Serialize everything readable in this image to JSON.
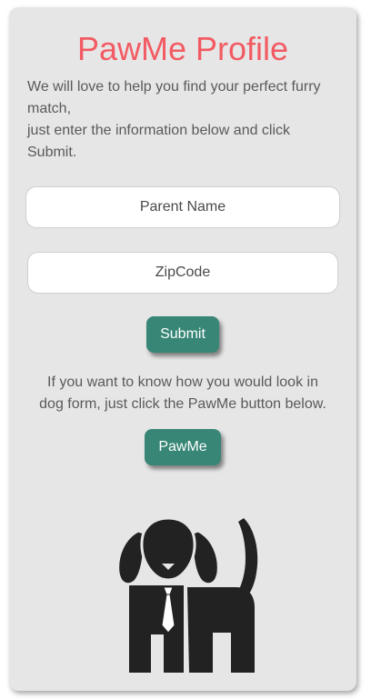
{
  "profile": {
    "title": "PawMe Profile",
    "intro_lines": [
      "We will love to help you find your perfect furry match,",
      "just enter the information below and click Submit."
    ]
  },
  "form": {
    "parent_name_placeholder": "Parent Name",
    "zipcode_placeholder": "ZipCode",
    "submit_label": "Submit"
  },
  "pawme": {
    "help_lines": [
      "If you want to know how you would look in",
      "dog form, just click the PawMe button below."
    ],
    "button_label": "PawMe"
  },
  "icons": {
    "dog_illustration": "dog-in-tie-icon"
  },
  "colors": {
    "title": "#f25b63",
    "button": "#378676",
    "card": "#e6e6e6",
    "dog": "#222222"
  }
}
